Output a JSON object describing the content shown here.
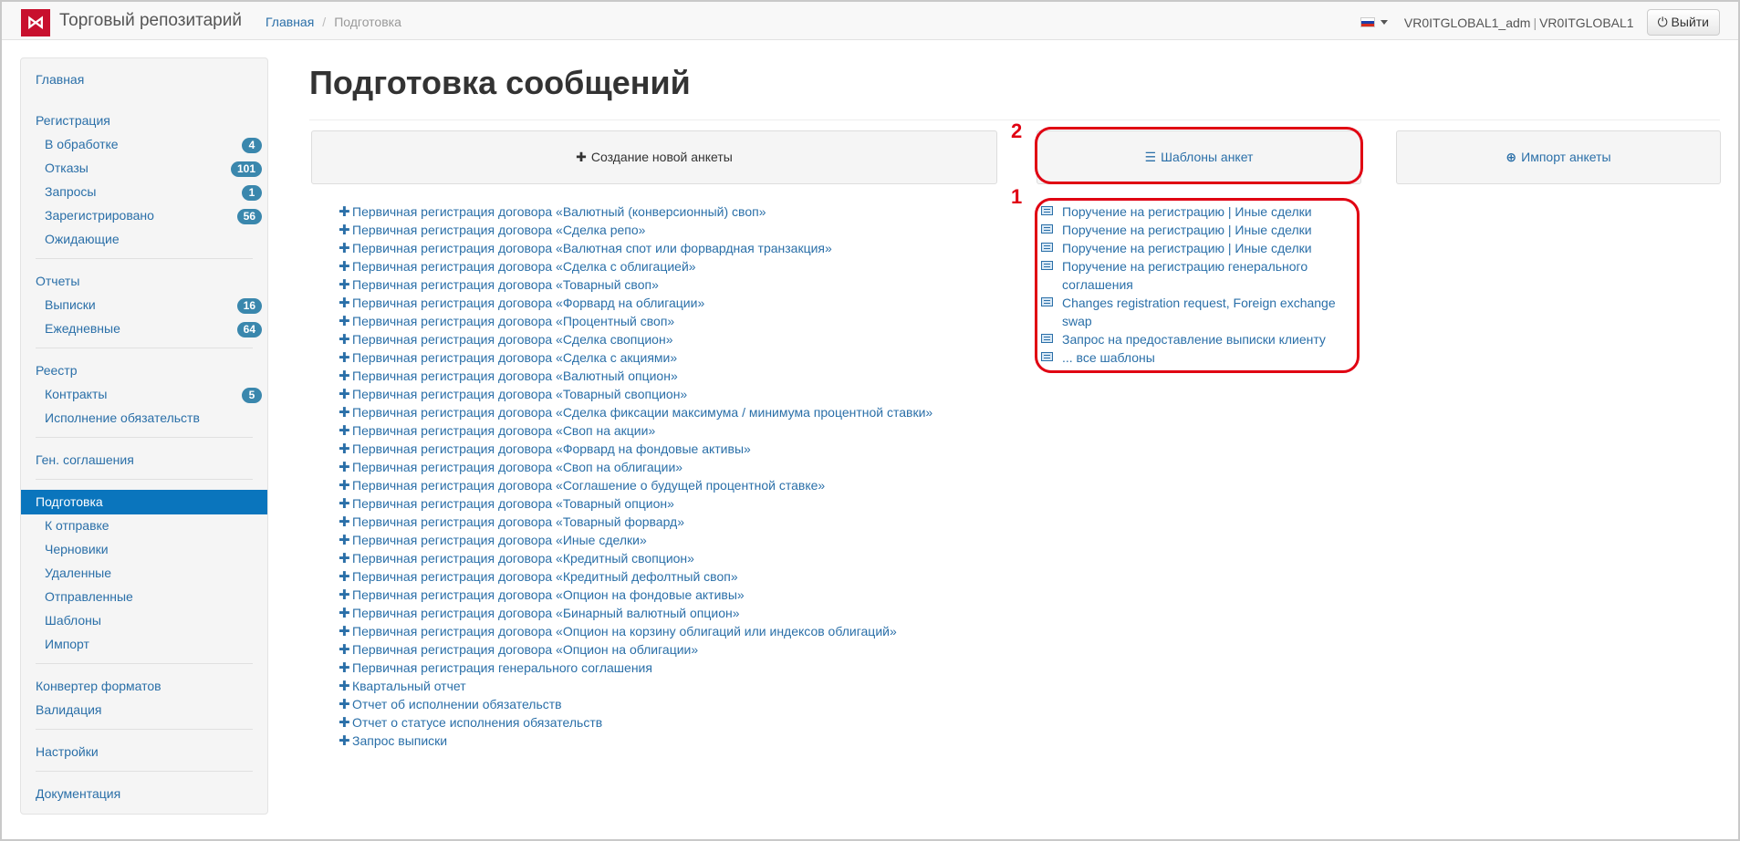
{
  "header": {
    "logo_glyph": "⋈",
    "brand": "Торговый репозитарий",
    "breadcrumb": {
      "home": "Главная",
      "current": "Подготовка"
    },
    "user": "VR0ITGLOBAL1_adm",
    "org": "VR0ITGLOBAL1",
    "logout_label": "Выйти",
    "logout_icon": "⏻"
  },
  "sidebar": {
    "main": "Главная",
    "registration": {
      "title": "Регистрация",
      "items": [
        {
          "label": "В обработке",
          "badge": "4"
        },
        {
          "label": "Отказы",
          "badge": "101"
        },
        {
          "label": "Запросы",
          "badge": "1"
        },
        {
          "label": "Зарегистрировано",
          "badge": "56"
        },
        {
          "label": "Ожидающие"
        }
      ]
    },
    "reports": {
      "title": "Отчеты",
      "items": [
        {
          "label": "Выписки",
          "badge": "16"
        },
        {
          "label": "Ежедневные",
          "badge": "64"
        }
      ]
    },
    "registry": {
      "title": "Реестр",
      "items": [
        {
          "label": "Контракты",
          "badge": "5"
        },
        {
          "label": "Исполнение обязательств"
        }
      ]
    },
    "gen_agreements": "Ген. соглашения",
    "preparation": {
      "title": "Подготовка",
      "items": [
        "К отправке",
        "Черновики",
        "Удаленные",
        "Отправленные",
        "Шаблоны",
        "Импорт"
      ]
    },
    "converter": "Конвертер форматов",
    "validation": "Валидация",
    "settings": "Настройки",
    "docs": "Документация"
  },
  "main": {
    "title": "Подготовка сообщений",
    "btn_new": "Создание новой анкеты",
    "btn_templates": "Шаблоны анкет",
    "btn_import": "Импорт анкеты",
    "registrations": [
      "Первичная регистрация договора «Валютный (конверсионный) своп»",
      "Первичная регистрация договора «Сделка репо»",
      "Первичная регистрация договора «Валютная спот или форвардная транзакция»",
      "Первичная регистрация договора «Сделка с облигацией»",
      "Первичная регистрация договора «Товарный своп»",
      "Первичная регистрация договора «Форвард на облигации»",
      "Первичная регистрация договора «Процентный своп»",
      "Первичная регистрация договора «Сделка свопцион»",
      "Первичная регистрация договора «Сделка с акциями»",
      "Первичная регистрация договора «Валютный опцион»",
      "Первичная регистрация договора «Товарный свопцион»",
      "Первичная регистрация договора «Сделка фиксации максимума / минимума процентной ставки»",
      "Первичная регистрация договора «Своп на акции»",
      "Первичная регистрация договора «Форвард на фондовые активы»",
      "Первичная регистрация договора «Своп на облигации»",
      "Первичная регистрация договора «Соглашение о будущей процентной ставке»",
      "Первичная регистрация договора «Товарный опцион»",
      "Первичная регистрация договора «Товарный форвард»",
      "Первичная регистрация договора «Иные сделки»",
      "Первичная регистрация договора «Кредитный свопцион»",
      "Первичная регистрация договора «Кредитный дефолтный своп»",
      "Первичная регистрация договора «Опцион на фондовые активы»",
      "Первичная регистрация договора «Бинарный валютный опцион»",
      "Первичная регистрация договора «Опцион на корзину облигаций или индексов облигаций»",
      "Первичная регистрация договора «Опцион на облигации»",
      "Первичная регистрация генерального соглашения",
      "Квартальный отчет",
      "Отчет об исполнении обязательств",
      "Отчет о статусе исполнения обязательств",
      "Запрос выписки"
    ],
    "templates": [
      "Поручение на регистрацию | Иные сделки",
      "Поручение на регистрацию | Иные сделки",
      "Поручение на регистрацию | Иные сделки",
      "Поручение на регистрацию генерального соглашения",
      "Changes registration request, Foreign exchange swap",
      "Запрос на предоставление выписки клиенту",
      "... все шаблоны"
    ],
    "annotation_1": "1",
    "annotation_2": "2"
  },
  "colors": {
    "accent": "#0a75bd",
    "link": "#2a6fa8",
    "badge": "#3a87ad",
    "annotation": "#e00012",
    "logo": "#c8102e"
  }
}
